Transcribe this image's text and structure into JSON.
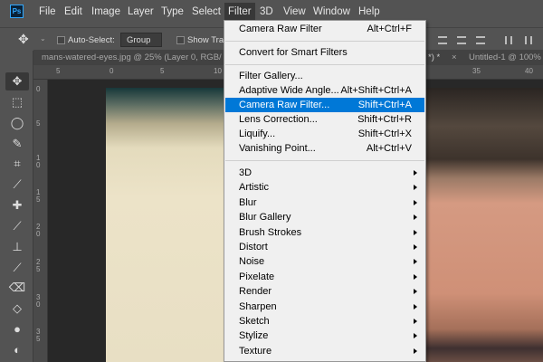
{
  "menubar": {
    "logo": "Ps",
    "items": [
      "File",
      "Edit",
      "Image",
      "Layer",
      "Type",
      "Select",
      "Filter",
      "3D",
      "View",
      "Window",
      "Help"
    ],
    "active": "Filter"
  },
  "options": {
    "auto_select_label": "Auto-Select:",
    "group_value": "Group",
    "show_transform_label": "Show Tran"
  },
  "tabs": {
    "doc1": "mans-watered-eyes.jpg @ 25% (Layer 0, RGB/",
    "doc1_suffix": "*) *",
    "close": "×",
    "doc2": "Untitled-1 @ 100%"
  },
  "rulers": {
    "h": [
      "5",
      "0",
      "5",
      "10",
      "35",
      "40"
    ],
    "v": [
      "0",
      "5",
      "10",
      "15",
      "20",
      "25",
      "30",
      "35"
    ]
  },
  "tools": [
    "move",
    "marquee",
    "lasso",
    "quick-selection",
    "crop",
    "eyedropper",
    "healing-brush",
    "brush",
    "clone-stamp",
    "history-brush",
    "eraser",
    "paint-bucket",
    "blur",
    "dodge"
  ],
  "filter_menu": {
    "top": [
      {
        "label": "Camera Raw Filter",
        "shortcut": "Alt+Ctrl+F"
      }
    ],
    "convert": {
      "label": "Convert for Smart Filters"
    },
    "filters": [
      {
        "label": "Filter Gallery...",
        "shortcut": ""
      },
      {
        "label": "Adaptive Wide Angle...",
        "shortcut": "Alt+Shift+Ctrl+A"
      },
      {
        "label": "Camera Raw Filter...",
        "shortcut": "Shift+Ctrl+A",
        "highlighted": true
      },
      {
        "label": "Lens Correction...",
        "shortcut": "Shift+Ctrl+R"
      },
      {
        "label": "Liquify...",
        "shortcut": "Shift+Ctrl+X"
      },
      {
        "label": "Vanishing Point...",
        "shortcut": "Alt+Ctrl+V"
      }
    ],
    "submenus": [
      "3D",
      "Artistic",
      "Blur",
      "Blur Gallery",
      "Brush Strokes",
      "Distort",
      "Noise",
      "Pixelate",
      "Render",
      "Sharpen",
      "Sketch",
      "Stylize",
      "Texture"
    ]
  },
  "colors": {
    "highlight": "#0078d7",
    "chrome": "#535353",
    "canvas": "#282828"
  }
}
